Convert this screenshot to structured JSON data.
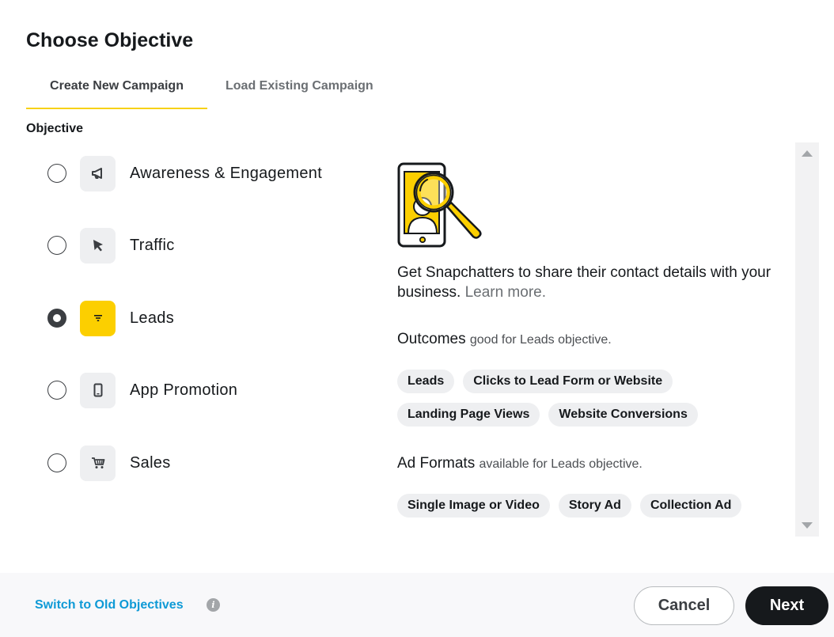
{
  "modal": {
    "title": "Choose Objective"
  },
  "tabs": [
    {
      "label": "Create New Campaign",
      "active": true
    },
    {
      "label": "Load Existing Campaign",
      "active": false
    }
  ],
  "objective_section": {
    "label": "Objective"
  },
  "objectives": [
    {
      "label": "Awareness & Engagement",
      "icon": "megaphone-icon",
      "selected": false
    },
    {
      "label": "Traffic",
      "icon": "cursor-arrow-icon",
      "selected": false
    },
    {
      "label": "Leads",
      "icon": "filter-icon",
      "selected": true
    },
    {
      "label": "App Promotion",
      "icon": "smartphone-icon",
      "selected": false
    },
    {
      "label": "Sales",
      "icon": "shopping-cart-icon",
      "selected": false
    }
  ],
  "detail": {
    "illustration_icon": "phone-magnifier-illustration",
    "description": "Get Snapchatters to share their contact details with your business.",
    "learn_more": "Learn more.",
    "outcomes_heading": "Outcomes",
    "outcomes_sub": "good for Leads objective.",
    "outcomes": [
      "Leads",
      "Clicks to Lead Form or Website",
      "Landing Page Views",
      "Website Conversions"
    ],
    "formats_heading": "Ad Formats",
    "formats_sub": "available for Leads objective.",
    "formats": [
      "Single Image or Video",
      "Story Ad",
      "Collection Ad"
    ]
  },
  "footer": {
    "old_objectives_link": "Switch to Old Objectives",
    "info_glyph": "i",
    "cancel_label": "Cancel",
    "next_label": "Next"
  },
  "colors": {
    "accent_yellow": "#fccf00",
    "link_blue": "#0e9ad6",
    "primary_dark": "#16191c"
  }
}
